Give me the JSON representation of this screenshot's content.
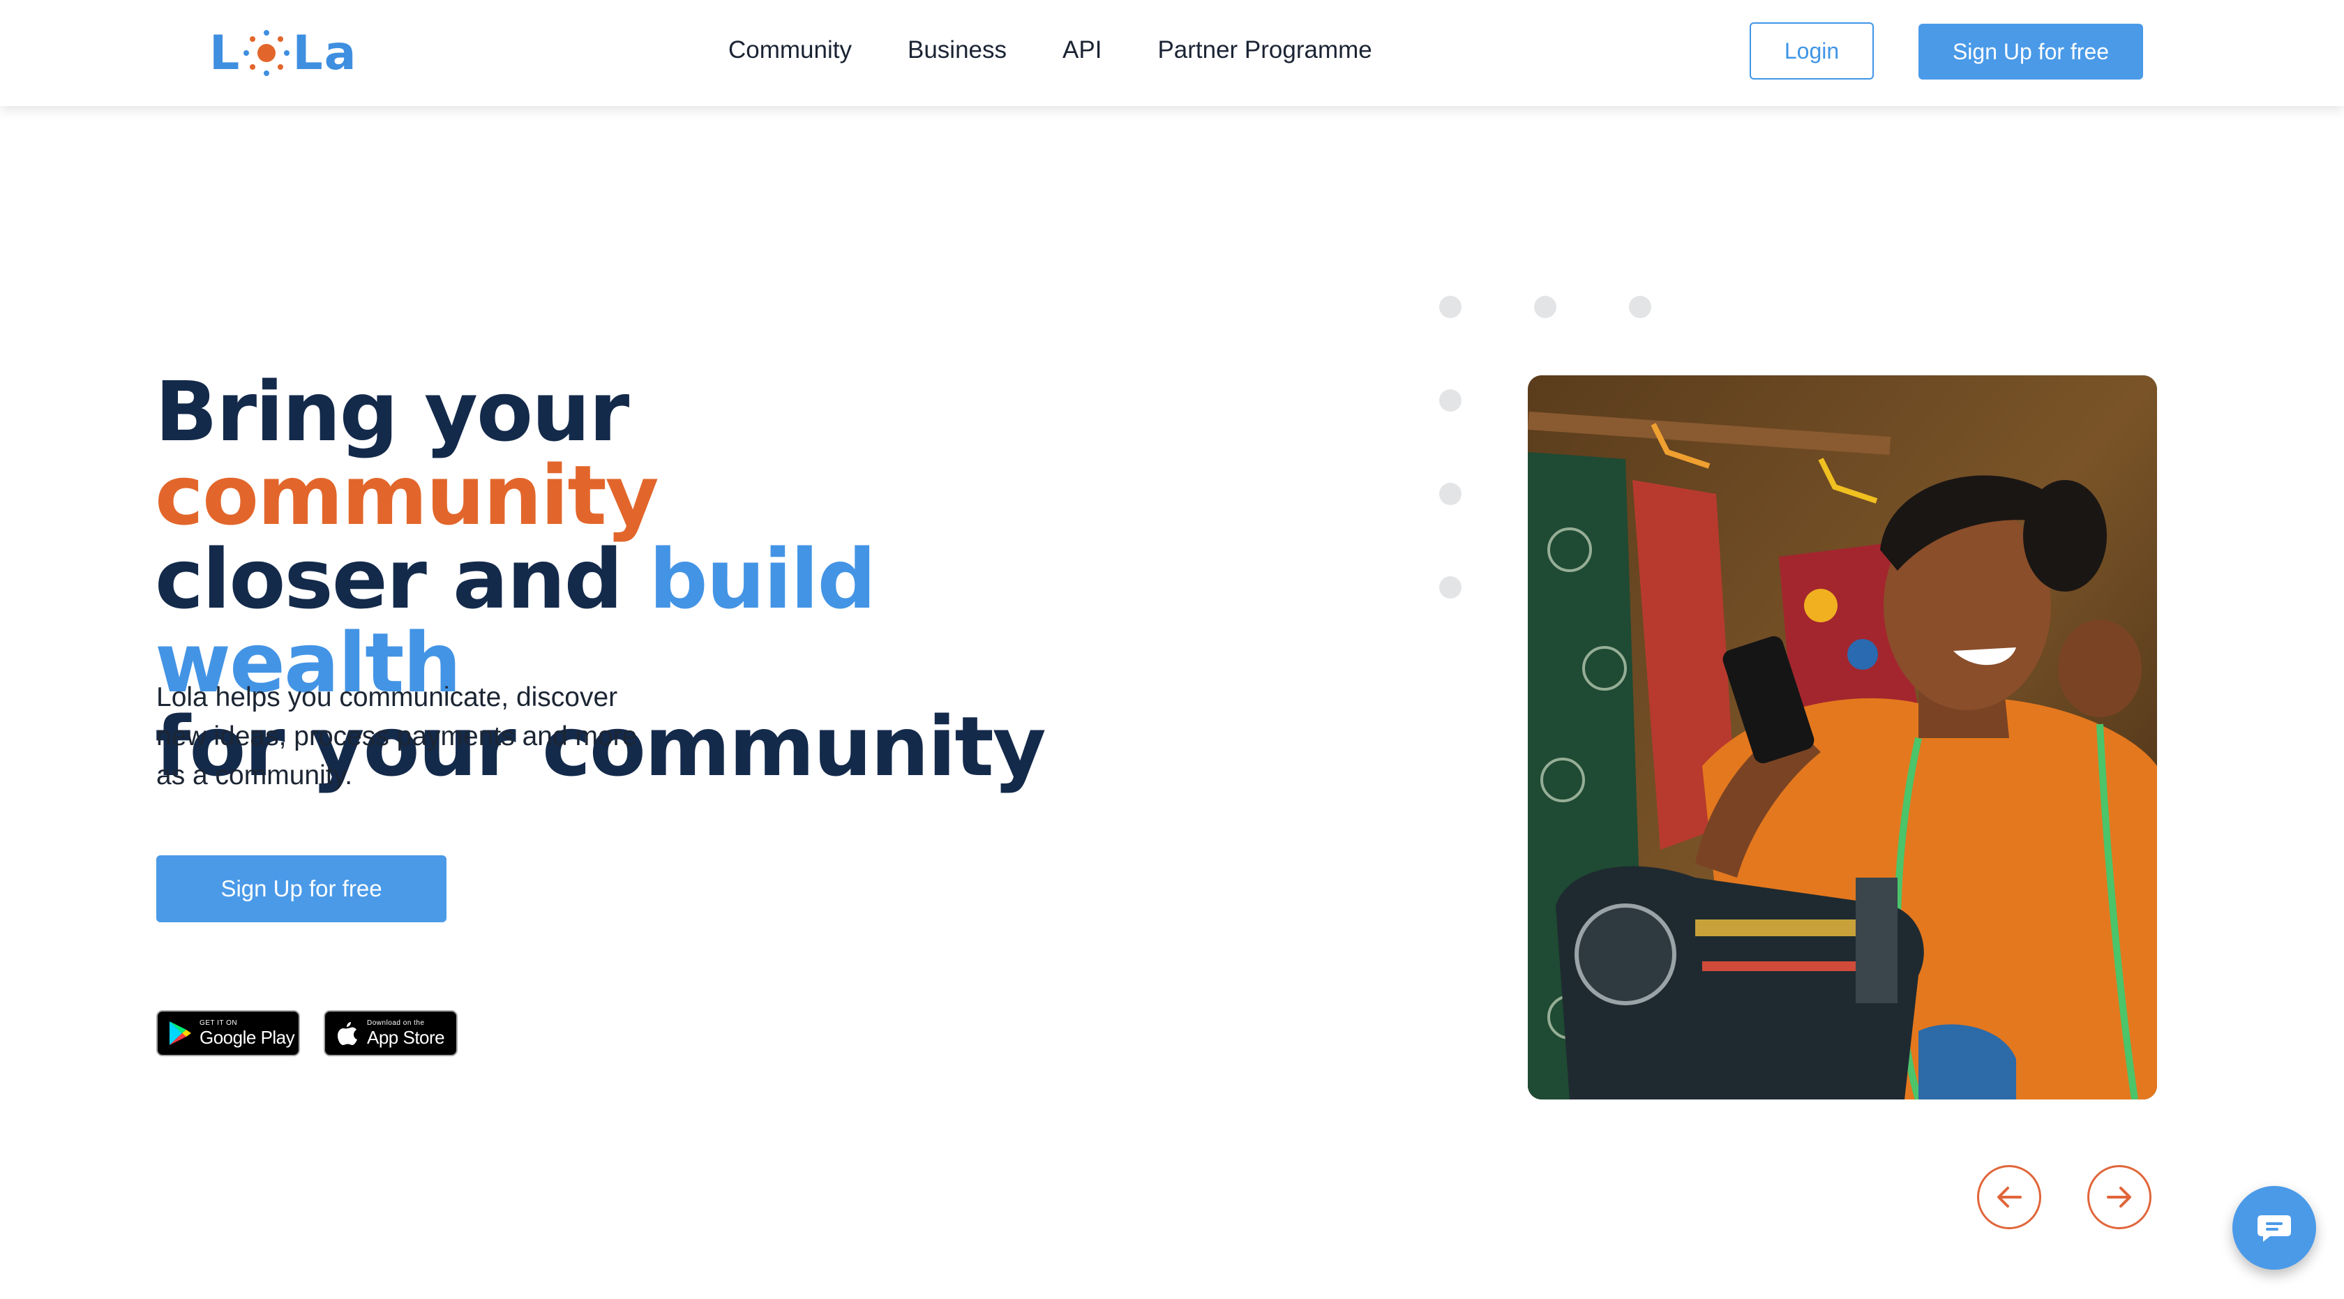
{
  "header": {
    "logo_text": "LoLa",
    "nav": [
      "Community",
      "Business",
      "API",
      "Partner Programme"
    ],
    "login_label": "Login",
    "signup_label": "Sign Up for free"
  },
  "hero": {
    "headline": {
      "part1": "Bring your ",
      "part2": "community",
      "part3": "closer and ",
      "part4": "build wealth",
      "part5": "for your community"
    },
    "description": "Lola helps you communicate, discover new ideas, process payments and more as a community.",
    "signup_label": "Sign Up for free"
  },
  "stores": {
    "google_small": "GET IT ON",
    "google_big": "Google Play",
    "apple_small": "Download on the",
    "apple_big": "App Store"
  },
  "carousel": {
    "prev_icon": "arrow-left-icon",
    "next_icon": "arrow-right-icon"
  },
  "chat": {
    "icon": "chat-bubble-icon"
  },
  "colors": {
    "navy": "#142a4b",
    "orange": "#e2662b",
    "blue": "#4394e5",
    "button_blue": "#4a9ae8",
    "arrow_orange": "#e0663a"
  }
}
